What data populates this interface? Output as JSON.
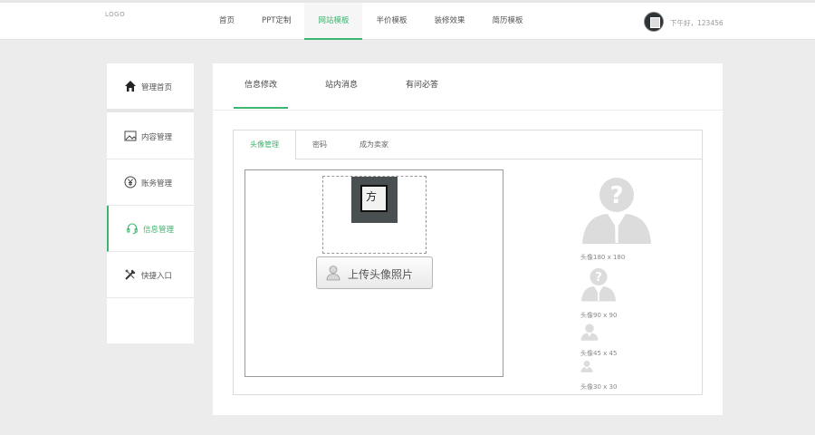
{
  "header": {
    "logo": "LOGO",
    "nav": [
      "首页",
      "PPT定制",
      "网站模板",
      "半价模板",
      "装修效果",
      "简历模板"
    ],
    "active_nav": "网站模板",
    "greeting": "下午好，123456"
  },
  "sidebar": {
    "items": [
      {
        "label": "管理首页",
        "icon": "home-icon"
      },
      {
        "label": "内容管理",
        "icon": "image-icon"
      },
      {
        "label": "账务管理",
        "icon": "yen-icon"
      },
      {
        "label": "信息管理",
        "icon": "headset-icon"
      },
      {
        "label": "快捷入口",
        "icon": "tools-icon"
      }
    ],
    "active": "信息管理"
  },
  "main": {
    "tabs": [
      "信息修改",
      "站内消息",
      "有问必答"
    ],
    "active_tab": "信息修改",
    "sub_tabs": [
      "头像管理",
      "密码",
      "成为卖家"
    ],
    "active_sub_tab": "头像管理",
    "upload_label": "上传头像照片",
    "thumb_char": "方",
    "previews": [
      "头像180 x 180",
      "头像90 x 90",
      "头像45 x 45",
      "头像30 x 30"
    ]
  },
  "colors": {
    "accent": "#3db56e",
    "placeholder": "#dcdcdc"
  }
}
